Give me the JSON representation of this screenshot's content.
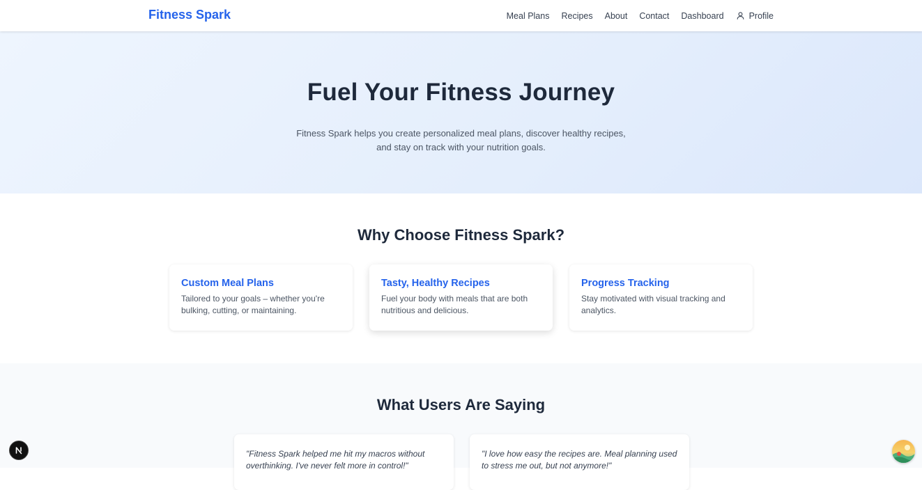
{
  "header": {
    "logo": "Fitness Spark",
    "nav": [
      {
        "label": "Meal Plans"
      },
      {
        "label": "Recipes"
      },
      {
        "label": "About"
      },
      {
        "label": "Contact"
      },
      {
        "label": "Dashboard"
      }
    ],
    "profile_label": "Profile",
    "profile_icon": "user-icon"
  },
  "hero": {
    "title": "Fuel Your Fitness Journey",
    "subtitle": "Fitness Spark helps you create personalized meal plans, discover healthy recipes, and stay on track with your nutrition goals."
  },
  "features": {
    "title": "Why Choose Fitness Spark?",
    "items": [
      {
        "title": "Custom Meal Plans",
        "description": "Tailored to your goals – whether you're bulking, cutting, or maintaining."
      },
      {
        "title": "Tasty, Healthy Recipes",
        "description": "Fuel your body with meals that are both nutritious and delicious."
      },
      {
        "title": "Progress Tracking",
        "description": "Stay motivated with visual tracking and analytics."
      }
    ]
  },
  "testimonials": {
    "title": "What Users Are Saying",
    "items": [
      {
        "quote": "\"Fitness Spark helped me hit my macros without overthinking. I've never felt more in control!\""
      },
      {
        "quote": "\"I love how easy the recipes are. Meal planning used to stress me out, but not anymore!\""
      }
    ]
  },
  "badges": {
    "next_icon": "next-logo-icon",
    "avatar_icon": "avatar-image"
  },
  "colors": {
    "brand": "#2563eb",
    "heading": "#1e293b",
    "body_text": "#4b5563",
    "hero_bg": "#e4eefc"
  }
}
